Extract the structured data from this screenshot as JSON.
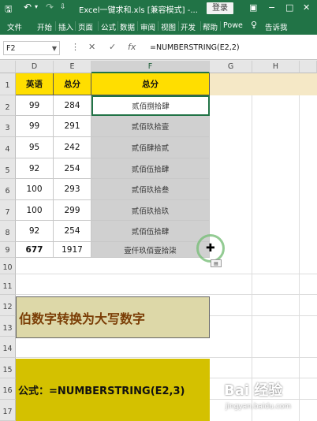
{
  "titlebar": {
    "save_icon": "save-icon",
    "undo_icon": "undo-icon",
    "title": "Excel一键求和.xls  [兼容模式]  -...",
    "login_label": "登录",
    "window_controls": [
      "−",
      "□",
      "✕"
    ]
  },
  "ribbon": {
    "tabs": [
      "文件",
      "开始",
      "插入",
      "页面 ",
      "公式",
      "数据",
      "审阅",
      "视图",
      "开发 ",
      "帮助",
      "Powe"
    ],
    "tell_me": "告诉我"
  },
  "formula_bar": {
    "name_box": "F2",
    "formula": "=NUMBERSTRING(E2,2)"
  },
  "columns": [
    "D",
    "E",
    "F",
    "G",
    "H"
  ],
  "row_numbers": [
    "1",
    "2",
    "3",
    "4",
    "5",
    "6",
    "7",
    "8",
    "9",
    "10",
    "11",
    "12",
    "13",
    "14",
    "15",
    "16",
    "17"
  ],
  "table": {
    "headers": [
      "英语",
      "总分",
      "总分"
    ],
    "rows": [
      [
        "99",
        "284",
        "贰佰捌拾肆"
      ],
      [
        "99",
        "291",
        "贰佰玖拾壹"
      ],
      [
        "95",
        "242",
        "贰佰肆拾贰"
      ],
      [
        "92",
        "254",
        "贰佰伍拾肆"
      ],
      [
        "100",
        "293",
        "贰佰玖拾叁"
      ],
      [
        "100",
        "299",
        "贰佰玖拾玖"
      ],
      [
        "92",
        "254",
        "贰佰伍拾肆"
      ],
      [
        "677",
        "1917",
        "壹仟玖佰壹拾柒"
      ]
    ]
  },
  "banner1": "伯数字转换为大写数字",
  "banner2": "公式：=NUMBERSTRING(E2,3)",
  "watermark": {
    "brand": "Bai 经验",
    "url": "jingyan.baidu.com"
  },
  "colors": {
    "excel_green": "#217346",
    "header_yellow": "#ffde00",
    "result_gray": "#d0d0d0",
    "banner_tan": "#ddd8a8",
    "banner_brown_text": "#7a3d05",
    "banner_yellow": "#d4c100"
  }
}
